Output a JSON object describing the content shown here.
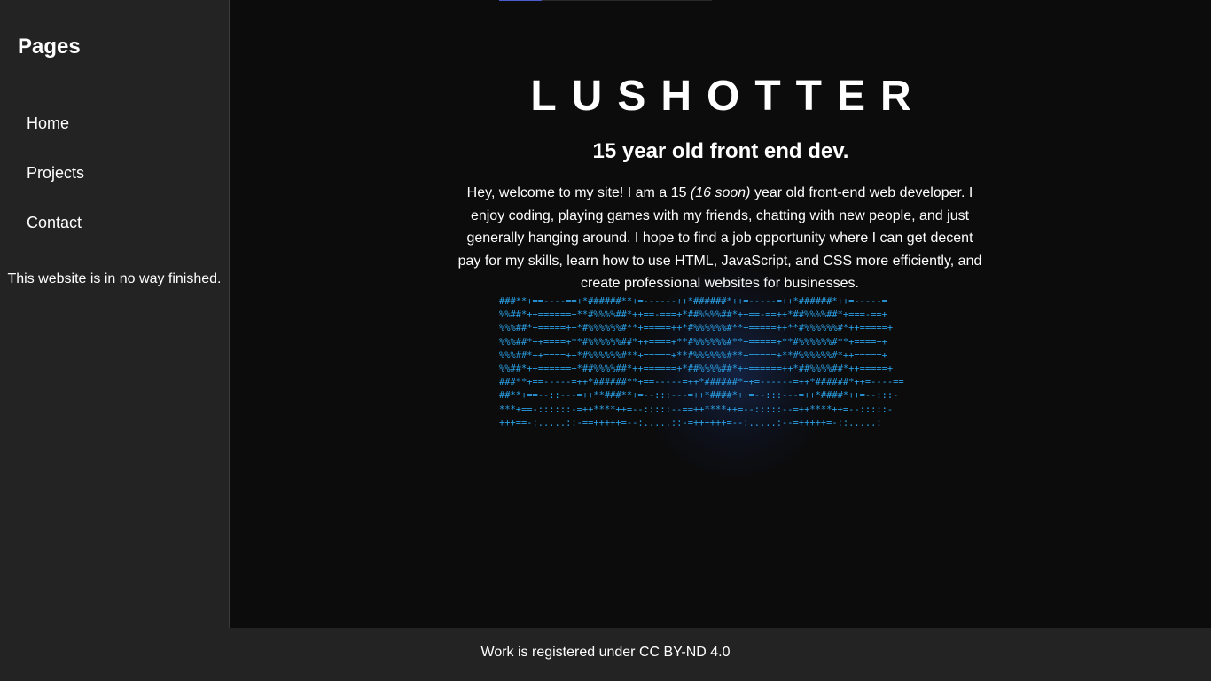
{
  "sidebar": {
    "heading": "Pages",
    "items": [
      {
        "label": "Home"
      },
      {
        "label": "Projects"
      },
      {
        "label": "Contact"
      }
    ],
    "note": "This website is in no way finished."
  },
  "main": {
    "title": "LUSHOTTER",
    "tagline": "15 year old front end dev.",
    "bio": {
      "part1": "Hey, welcome to my site! I am a 15 ",
      "italic": "(16 soon)",
      "part2": " year old front-end web developer. I enjoy coding, playing games with my friends, chatting with new people, and just generally hanging around. I hope to find a job opportunity where I can get decent pay for my skills, learn how to use HTML, JavaScript, and CSS more efficiently, and create professional websites for businesses."
    },
    "ascii_art": "###**+==----==+*######**+=------++*######*++=-----=++*######*++=-----=\n%%##*++======+**#%%%%##*++==-===+*##%%%%##*++==-==++*##%%%%##*+===-==+\n%%%##*+=====++*#%%%%%%#**+=====++*#%%%%%%#**+=====++**#%%%%%%#*++=====+\n%%%##*++====+**#%%%%%%##*++====+**#%%%%%%#**+=====+**#%%%%%%#**+====++\n%%%##*++====++*#%%%%%%#**+=====+**#%%%%%%#**+=====+**#%%%%%%#*++=====+\n%%##*++======+*##%%%%##*++======+*##%%%%##*++======++*##%%%%##*++=====+\n###**+==-----=++*######**+==-----=++*######*++=------=++*######*++=----==\n##**+==--::---=++**###**+=--:::---=++*####*++=--:::---=++*####*++=--:::-\n***+==-::::::-=++****++=--:::::--==++****++=--:::::--=++****++=--:::::-\n+++==-:.....::-==+++++=--:.....::-=++++++=--:.....:--=+++++=-::.....:",
    "ascii_color": "#2aa0e6"
  },
  "footer": {
    "text": "Work is registered under CC BY-ND 4.0"
  },
  "colors": {
    "background": "#0c0c0c",
    "panel": "#232323",
    "text": "#ffffff",
    "accent": "#4a5bd0"
  }
}
